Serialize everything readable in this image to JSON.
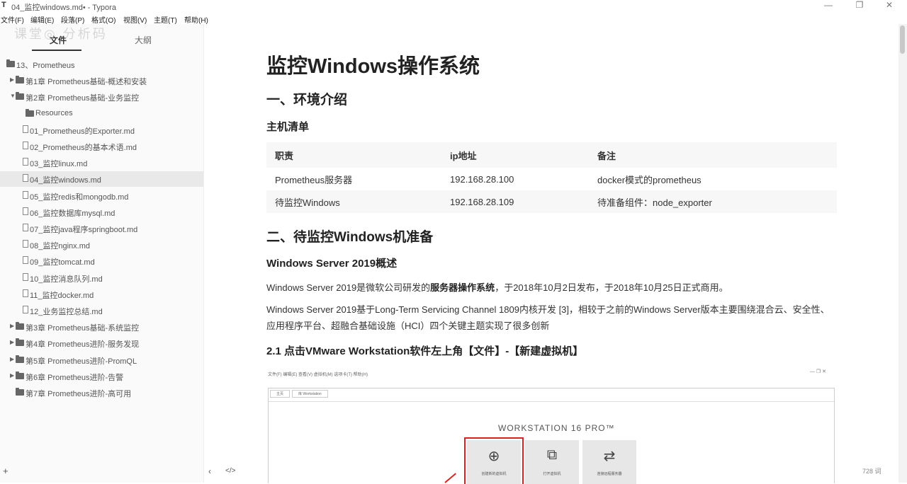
{
  "window": {
    "logo": "T",
    "title": "04_监控windows.md• - Typora",
    "minimize": "—",
    "restore": "❐",
    "close": "✕"
  },
  "menu": [
    "文件(F)",
    "编辑(E)",
    "段落(P)",
    "格式(O)",
    "视图(V)",
    "主题(T)",
    "帮助(H)"
  ],
  "watermark": "课堂◎ 分析码",
  "sidebar": {
    "tab_files": "文件",
    "tab_outline": "大纲",
    "tree": [
      {
        "label": "13、Prometheus",
        "type": "folder",
        "level": 0,
        "caret": ""
      },
      {
        "label": "第1章 Prometheus基础-概述和安装",
        "type": "folder",
        "level": 1,
        "caret": "▶"
      },
      {
        "label": "第2章 Prometheus基础-业务监控",
        "type": "folder",
        "level": 1,
        "caret": "▼"
      },
      {
        "label": "Resources",
        "type": "folder",
        "level": 2,
        "caret": ""
      },
      {
        "label": "01_Prometheus的Exporter.md",
        "type": "file",
        "level": 2
      },
      {
        "label": "02_Prometheus的基本术语.md",
        "type": "file",
        "level": 2
      },
      {
        "label": "03_监控linux.md",
        "type": "file",
        "level": 2
      },
      {
        "label": "04_监控windows.md",
        "type": "file",
        "level": 2,
        "active": true
      },
      {
        "label": "05_监控redis和mongodb.md",
        "type": "file",
        "level": 2
      },
      {
        "label": "06_监控数据库mysql.md",
        "type": "file",
        "level": 2
      },
      {
        "label": "07_监控java程序springboot.md",
        "type": "file",
        "level": 2
      },
      {
        "label": "08_监控nginx.md",
        "type": "file",
        "level": 2
      },
      {
        "label": "09_监控tomcat.md",
        "type": "file",
        "level": 2
      },
      {
        "label": "10_监控消息队列.md",
        "type": "file",
        "level": 2
      },
      {
        "label": "11_监控docker.md",
        "type": "file",
        "level": 2
      },
      {
        "label": "12_业务监控总结.md",
        "type": "file",
        "level": 2
      },
      {
        "label": "第3章 Prometheus基础-系统监控",
        "type": "folder",
        "level": 1,
        "caret": "▶"
      },
      {
        "label": "第4章 Prometheus进阶-服务发现",
        "type": "folder",
        "level": 1,
        "caret": "▶"
      },
      {
        "label": "第5章 Prometheus进阶-PromQL",
        "type": "folder",
        "level": 1,
        "caret": "▶"
      },
      {
        "label": "第6章 Prometheus进阶-告警",
        "type": "folder",
        "level": 1,
        "caret": "▶"
      },
      {
        "label": "第7章 Prometheus进阶-高可用",
        "type": "folder",
        "level": 1,
        "caret": ""
      }
    ],
    "add_label": "+"
  },
  "doc": {
    "title": "监控Windows操作系统",
    "h2_env": "一、环境介绍",
    "h3_hosts": "主机清单",
    "table": {
      "headers": [
        "职责",
        "ip地址",
        "备注"
      ],
      "rows": [
        [
          "Prometheus服务器",
          "192.168.28.100",
          "docker模式的prometheus"
        ],
        [
          "待监控Windows",
          "192.168.28.109",
          "待准备组件：node_exporter"
        ]
      ]
    },
    "h2_prep": "二、待监控Windows机准备",
    "h3_ws": "Windows Server 2019概述",
    "p1_a": "Windows Server 2019是微软公司研发的",
    "p1_b": "服务器操作系统",
    "p1_c": "，于2018年10月2日发布，于2018年10月25日正式商用。",
    "p2": "Windows Server 2019基于Long-Term Servicing Channel 1809内核开发 [3]，相较于之前的Windows Server版本主要围绕混合云、安全性、应用程序平台、超融合基础设施（HCI）四个关键主题实现了很多创新",
    "h3_step": "2.1 点击VMware Workstation软件左上角【文件】-【新建虚拟机】"
  },
  "screenshot": {
    "menu": "文件(F)  编辑(E)  查看(V)  虚拟机(M)  选项卡(T)  帮助(H)",
    "controls": "—   ❐   ✕",
    "tab_home": "主页",
    "tab_library": "库 Workstation",
    "brand": "WORKSTATION 16 PRO™",
    "cards": [
      {
        "icon": "⊕",
        "label": "创建新的虚拟机",
        "selected": true
      },
      {
        "icon": "⧉",
        "label": "打开虚拟机",
        "selected": false
      },
      {
        "icon": "⇄",
        "label": "连接远程服务器",
        "selected": false
      }
    ]
  },
  "footer": {
    "back": "‹",
    "source": "</>",
    "word_count": "728 词"
  }
}
